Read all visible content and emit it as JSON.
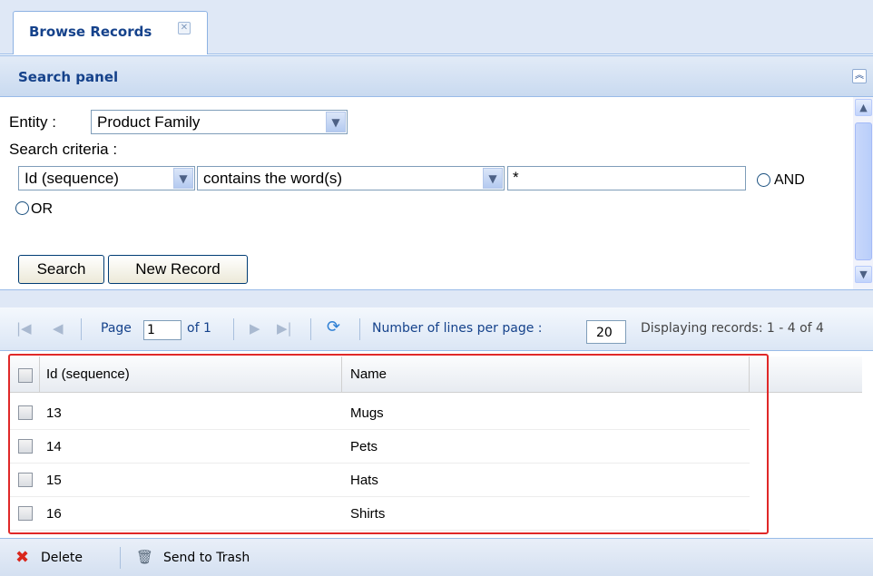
{
  "tab": {
    "label": "Browse Records"
  },
  "panel": {
    "title": "Search panel"
  },
  "form": {
    "entity_label": "Entity :",
    "entity_value": "Product Family",
    "criteria_label": "Search criteria :",
    "field_value": "Id (sequence)",
    "operator_value": "contains the word(s)",
    "search_value": "*",
    "and_label": "AND",
    "or_label": "OR",
    "search_button": "Search",
    "new_record_button": "New Record"
  },
  "paging": {
    "page_label": "Page",
    "page_value": "1",
    "of_label": "of 1",
    "lines_label": "Number of lines per page :",
    "lines_value": "20",
    "displaying": "Displaying records: 1 - 4 of 4"
  },
  "grid": {
    "columns": [
      "Id (sequence)",
      "Name"
    ],
    "rows": [
      {
        "id": "13",
        "name": "Mugs"
      },
      {
        "id": "14",
        "name": "Pets"
      },
      {
        "id": "15",
        "name": "Hats"
      },
      {
        "id": "16",
        "name": "Shirts"
      }
    ]
  },
  "actions": {
    "delete": "Delete",
    "trash": "Send to Trash"
  },
  "colors": {
    "header_blue": "#15428b",
    "highlight": "#e02828",
    "delete_red": "#d9261c"
  }
}
